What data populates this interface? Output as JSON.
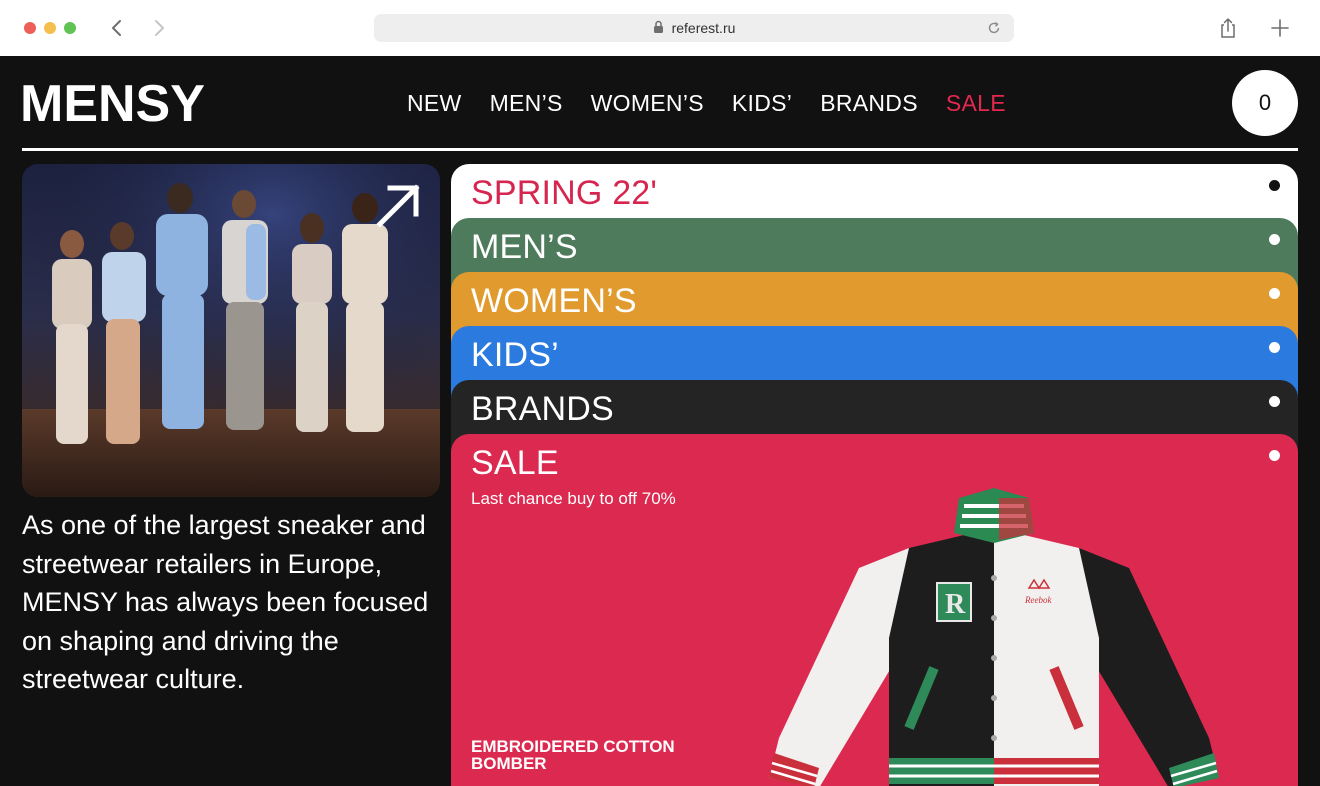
{
  "browser": {
    "url": "referest.ru"
  },
  "site": {
    "logo": "MENSY",
    "nav": [
      {
        "label": "NEW"
      },
      {
        "label": "MEN’S"
      },
      {
        "label": "WOMEN’S"
      },
      {
        "label": "KIDS’"
      },
      {
        "label": "BRANDS"
      },
      {
        "label": "SALE"
      }
    ],
    "cart_count": "0",
    "intro": "As one of the largest sneaker and streetwear retailers in Europe, MENSY has always been focused on shaping and driving the streetwear culture."
  },
  "categories": {
    "spring": "SPRING 22'",
    "men": "MEN’S",
    "women": "WOMEN’S",
    "kids": "KIDS’",
    "brands": "BRANDS",
    "sale": "SALE",
    "sale_subtitle": "Last chance buy to off 70%",
    "product_name": "EMBROIDERED COTTON BOMBER"
  },
  "colors": {
    "accent_sale": "#e3284f",
    "mens": "#4f7b5d",
    "womens": "#e19a2e",
    "kids": "#2b7ae0",
    "brands": "#242424",
    "sale": "#dc2950"
  },
  "icons": {
    "back": "chevron-left-icon",
    "forward": "chevron-right-icon",
    "lock": "lock-icon",
    "reload": "reload-icon",
    "share": "share-icon",
    "new_tab": "plus-icon",
    "hero_link": "arrow-up-right-icon"
  }
}
